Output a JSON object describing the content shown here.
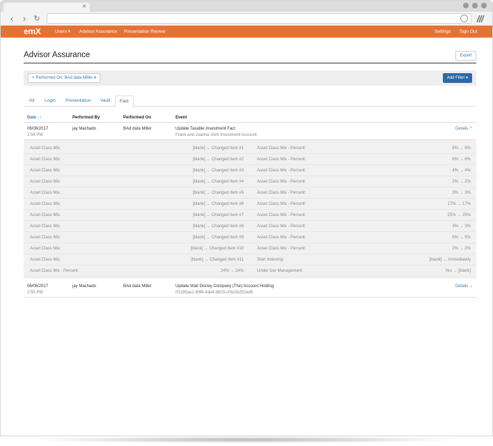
{
  "browser": {
    "tab_close": "×",
    "nav": {
      "back": "‹",
      "forward": "›",
      "reload": "↻"
    }
  },
  "appnav": {
    "logo_text": "em",
    "logo_x": "X",
    "users_label": "Users ▾",
    "advisor_assurance_label": "Advisor Assurance",
    "presentation_review_label": "Presentation Review",
    "settings_label": "Settings",
    "signout_label": "Sign Out"
  },
  "page": {
    "title": "Advisor Assurance",
    "export_label": "Export"
  },
  "filters": {
    "chip_remove": "×",
    "chip_label": "Performed On: BAd data Miller ▾",
    "add_filter_label": "Add Filter ▾"
  },
  "tabs": [
    "All",
    "Login",
    "Presentation",
    "Vault",
    "Fact"
  ],
  "active_tab": "Fact",
  "table": {
    "headers": {
      "date": "Date ↓↑",
      "performed_by": "Performed By",
      "performed_on": "Performed On",
      "event": "Event"
    },
    "rows": [
      {
        "date": "06/06/2017",
        "time": "2:56 PM",
        "performed_by": "jay Machado",
        "performed_on": "BAd data Miller",
        "event": "Update Taxable Investment Fact",
        "event_sub": "Frank and Joanna Joint Investment Account",
        "details_label": "Details ⌃"
      },
      {
        "date": "06/06/2017",
        "time": "2:55 PM",
        "performed_by": "jay Machado",
        "performed_on": "BAd data Miller",
        "event": "Update Walt Disney Company (The) Account Holding",
        "event_sub": "03185ae1-6f86-4ab4-b603-cf0e2b292ed6",
        "details_label": "Details ⌄"
      }
    ]
  },
  "details": [
    {
      "l1": "Asset Class Mix:",
      "v1": "[blank] → Changed Item #1",
      "l2": "Asset Class Mix - Percent:",
      "v2": "8% → 8%"
    },
    {
      "l1": "Asset Class Mix:",
      "v1": "[blank] → Changed Item #2",
      "l2": "Asset Class Mix - Percent:",
      "v2": "6% → 6%"
    },
    {
      "l1": "Asset Class Mix:",
      "v1": "[blank] → Changed Item #3",
      "l2": "Asset Class Mix - Percent:",
      "v2": "4% → 4%"
    },
    {
      "l1": "Asset Class Mix:",
      "v1": "[blank] → Changed Item #4",
      "l2": "Asset Class Mix - Percent:",
      "v2": "2% → 2%"
    },
    {
      "l1": "Asset Class Mix:",
      "v1": "[blank] → Changed Item #5",
      "l2": "Asset Class Mix - Percent:",
      "v2": "3% → 3%"
    },
    {
      "l1": "Asset Class Mix:",
      "v1": "[blank] → Changed Item #6",
      "l2": "Asset Class Mix - Percent:",
      "v2": "17% → 17%"
    },
    {
      "l1": "Asset Class Mix:",
      "v1": "[blank] → Changed Item #7",
      "l2": "Asset Class Mix - Percent:",
      "v2": "25% → 25%"
    },
    {
      "l1": "Asset Class Mix:",
      "v1": "[blank] → Changed Item #8",
      "l2": "Asset Class Mix - Percent:",
      "v2": "3% → 3%"
    },
    {
      "l1": "Asset Class Mix:",
      "v1": "[blank] → Changed Item #9",
      "l2": "Asset Class Mix - Percent:",
      "v2": "5% → 5%"
    },
    {
      "l1": "Asset Class Mix:",
      "v1": "[blank] → Changed Item #10",
      "l2": "Asset Class Mix - Percent:",
      "v2": "2% → 2%"
    },
    {
      "l1": "Asset Class Mix:",
      "v1": "[blank] → Changed Item #11",
      "l2": "Start Indexing:",
      "v2": "[blank] → Immediately"
    },
    {
      "l1": "Asset Class Mix - Percent:",
      "v1": "24% → 24%",
      "l2": "Under Our Management:",
      "v2": "Yes → [blank]"
    }
  ],
  "colors": {
    "brand": "#e8712f",
    "link": "#337ab7",
    "primary_button": "#2c6aa7"
  }
}
